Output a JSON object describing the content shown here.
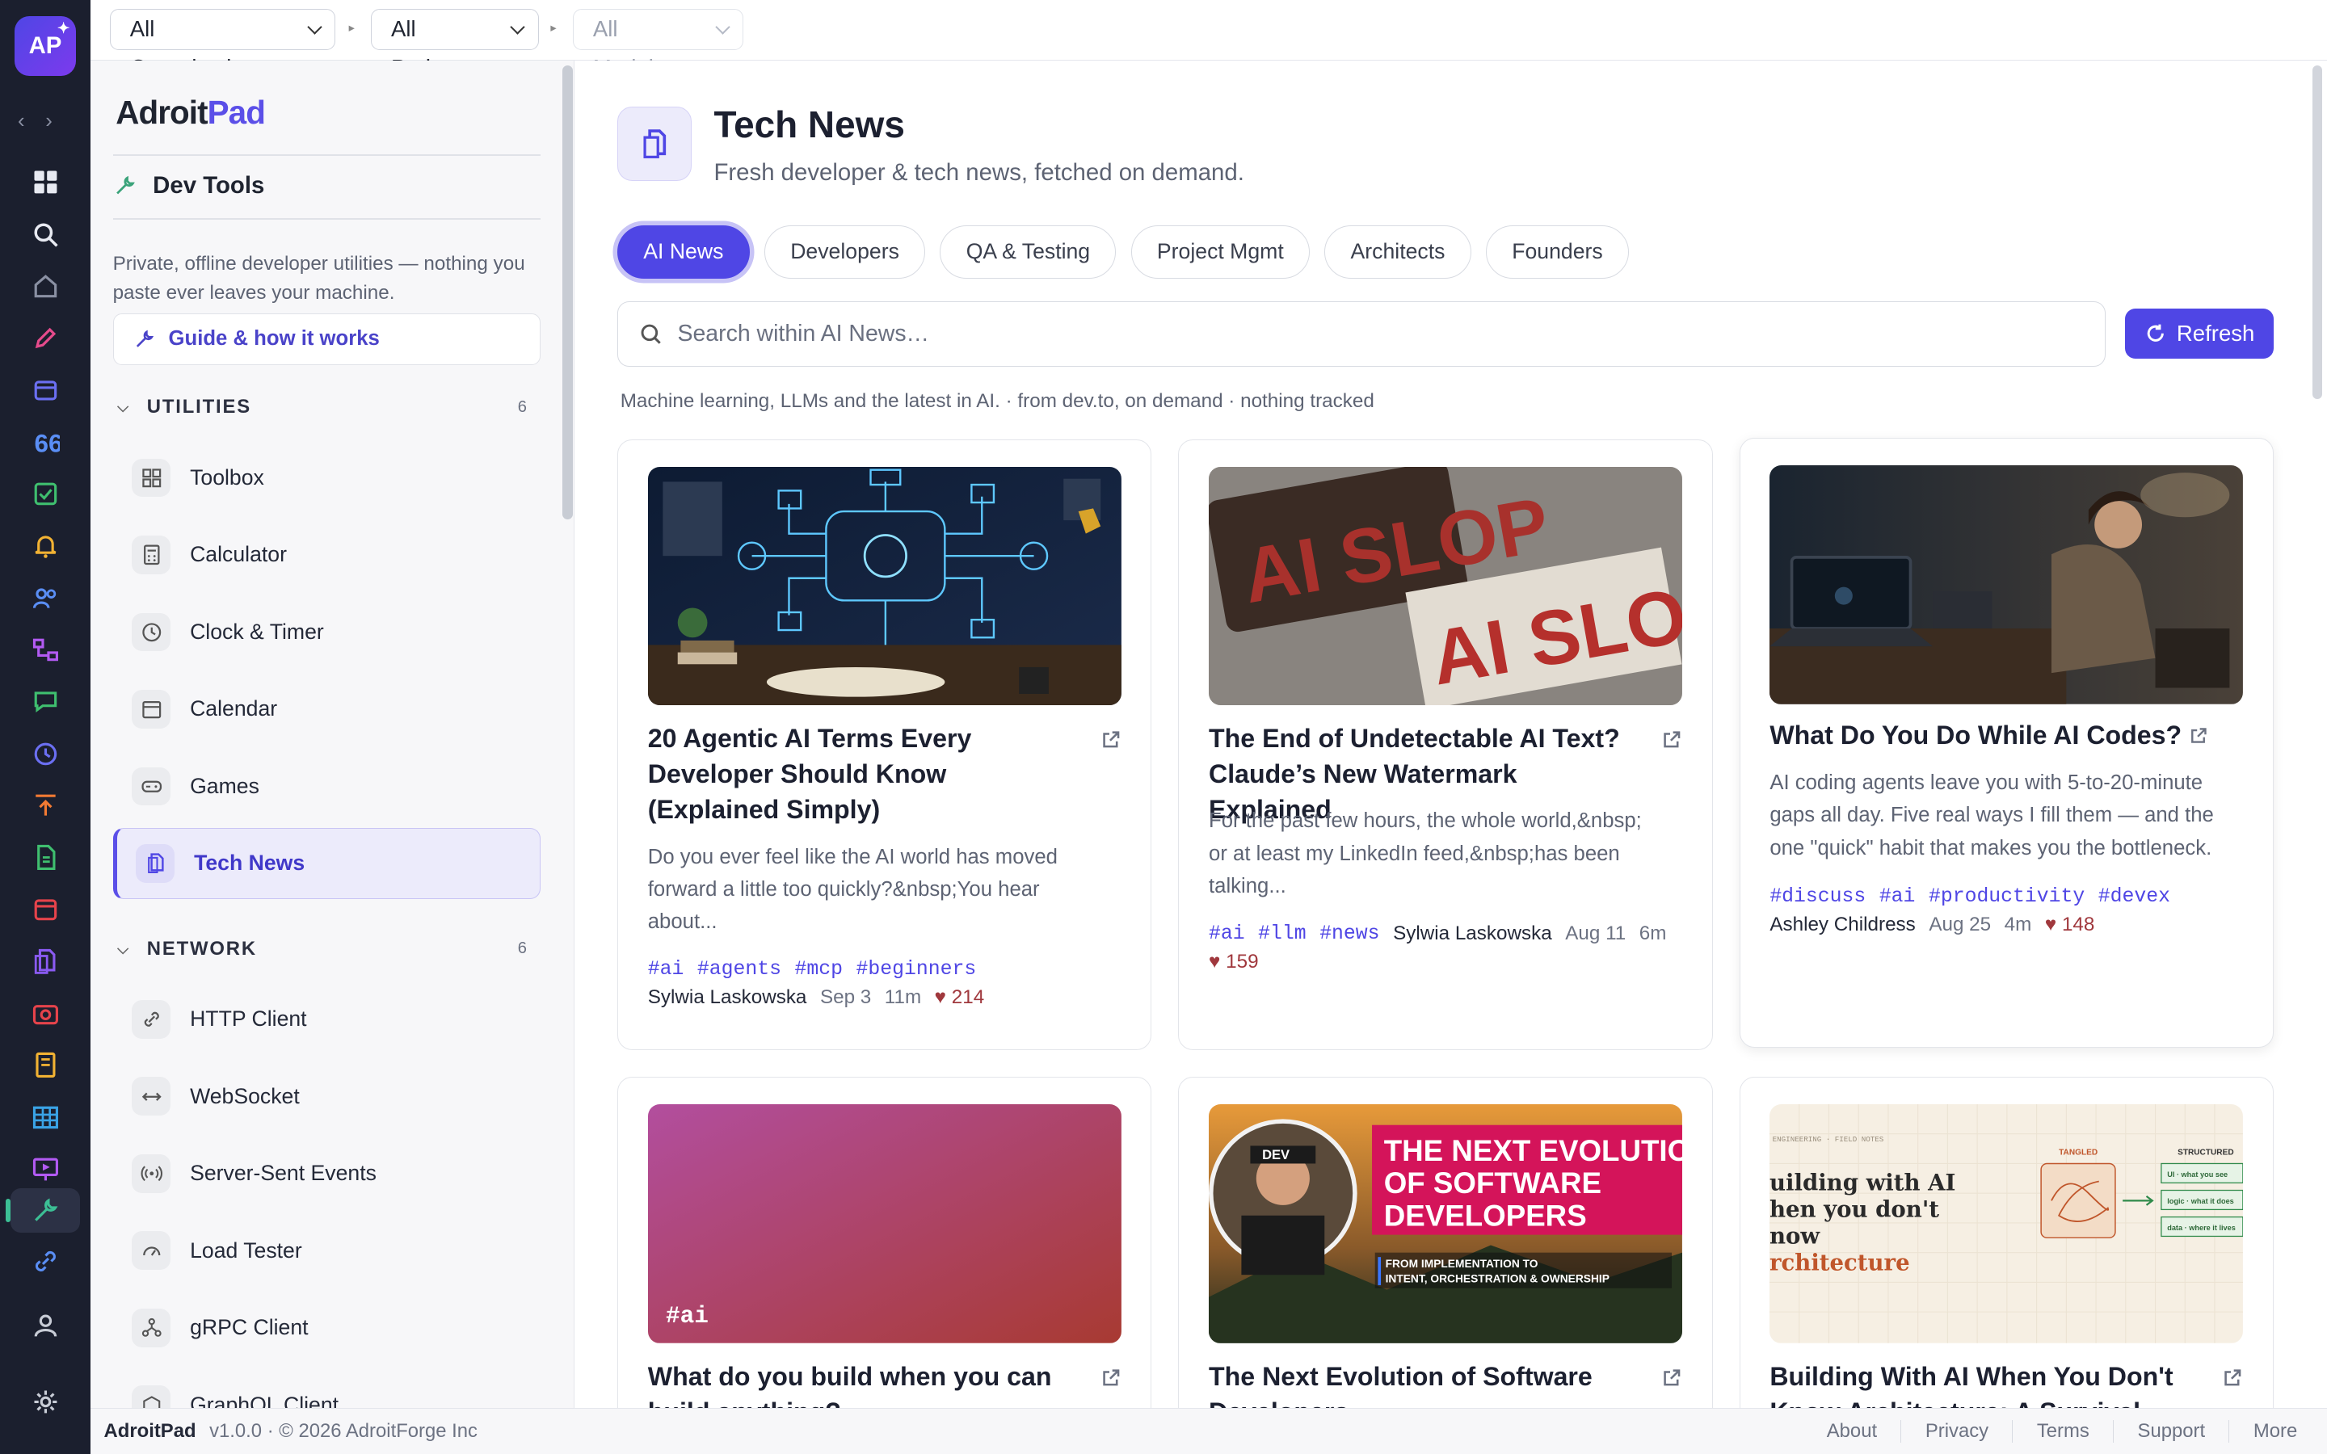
{
  "app": {
    "logo_text": "AP",
    "brand_prefix": "Adroit",
    "brand_suffix": "Pad",
    "section": "Dev Tools",
    "intro": "Private, offline developer utilities — nothing you paste ever leaves your machine.",
    "guide_label": "Guide & how it works"
  },
  "topbar": {
    "org": "All Organisations",
    "project": "All Projects",
    "module": "All Modules"
  },
  "sidebar": {
    "utilities": {
      "label": "UTILITIES",
      "count": "6",
      "items": [
        {
          "label": "Toolbox"
        },
        {
          "label": "Calculator"
        },
        {
          "label": "Clock & Timer"
        },
        {
          "label": "Calendar"
        },
        {
          "label": "Games"
        },
        {
          "label": "Tech News"
        }
      ]
    },
    "network": {
      "label": "NETWORK",
      "count": "6",
      "items": [
        {
          "label": "HTTP Client"
        },
        {
          "label": "WebSocket"
        },
        {
          "label": "Server-Sent Events"
        },
        {
          "label": "Load Tester"
        },
        {
          "label": "gRPC Client"
        },
        {
          "label": "GraphQL Client"
        }
      ]
    }
  },
  "main": {
    "title": "Tech News",
    "subtitle": "Fresh developer & tech news, fetched on demand.",
    "tabs": [
      {
        "label": "AI News"
      },
      {
        "label": "Developers"
      },
      {
        "label": "QA & Testing"
      },
      {
        "label": "Project Mgmt"
      },
      {
        "label": "Architects"
      },
      {
        "label": "Founders"
      }
    ],
    "active_tab": "AI News",
    "search_placeholder": "Search within AI News…",
    "refresh_label": "Refresh",
    "meta": "Machine learning, LLMs and the latest in AI. · from dev.to, on demand · nothing tracked",
    "cards": [
      {
        "title": "20 Agentic AI Terms Every Developer Should Know (Explained Simply)",
        "desc": "Do you ever feel like the AI world has moved forward a little too quickly?&nbsp;You hear about...",
        "tags": [
          "#ai",
          "#agents",
          "#mcp",
          "#beginners"
        ],
        "author": "Sylwia Laskowska",
        "date": "Sep 3",
        "read": "11m",
        "likes": "214"
      },
      {
        "title": "The End of Undetectable AI Text? Claude’s New Watermark Explained",
        "desc": "For the past few hours, the whole world,&nbsp; or at least my LinkedIn feed,&nbsp;has been talking...",
        "tags": [
          "#ai",
          "#llm",
          "#news"
        ],
        "author": "Sylwia Laskowska",
        "date": "Aug 11",
        "read": "6m",
        "likes": "159",
        "thumb_text_1": "AI SLOP",
        "thumb_text_2": "AI SLOP"
      },
      {
        "title": "What Do You Do While AI Codes?",
        "desc": "AI coding agents leave you with 5-to-20-minute gaps all day. Five real ways I fill them — and the one \"quick\" habit that makes you the bottleneck.",
        "tags": [
          "#discuss",
          "#ai",
          "#productivity",
          "#devex"
        ],
        "author": "Ashley Childress",
        "date": "Aug 25",
        "read": "4m",
        "likes": "148"
      },
      {
        "title": "What do you build when you can build anything?",
        "thumb_tag": "#ai"
      },
      {
        "title": "The Next Evolution of Software Developers",
        "thumb_line1": "THE NEXT EVOLUTION",
        "thumb_line2": "OF SOFTWARE",
        "thumb_line3": "DEVELOPERS",
        "thumb_sub1": "FROM IMPLEMENTATION TO",
        "thumb_sub2": "INTENT, ORCHESTRATION & OWNERSHIP",
        "thumb_badge": "DEV"
      },
      {
        "title": "Building With AI When You Don't Know Architecture: A Survival Guide",
        "thumb_kicker": "ENGINEERING · FIELD NOTES",
        "thumb_h1": "uilding with AI",
        "thumb_h2": "hen you don't",
        "thumb_h3": "now",
        "thumb_h4": "rchitecture",
        "thumb_tangled": "TANGLED",
        "thumb_structured": "STRUCTURED",
        "thumb_box1": "UI · what you see",
        "thumb_box2": "logic · what it does",
        "thumb_box3": "data · where it lives"
      }
    ]
  },
  "footer": {
    "brand": "AdroitPad",
    "version": "v1.0.0",
    "copyright": "· © 2026 AdroitForge Inc",
    "links": [
      "About",
      "Privacy",
      "Terms",
      "Support",
      "More"
    ]
  },
  "colors": {
    "accent": "#4f46e5",
    "rail": "#1b1f2e",
    "like": "#a0383d"
  }
}
